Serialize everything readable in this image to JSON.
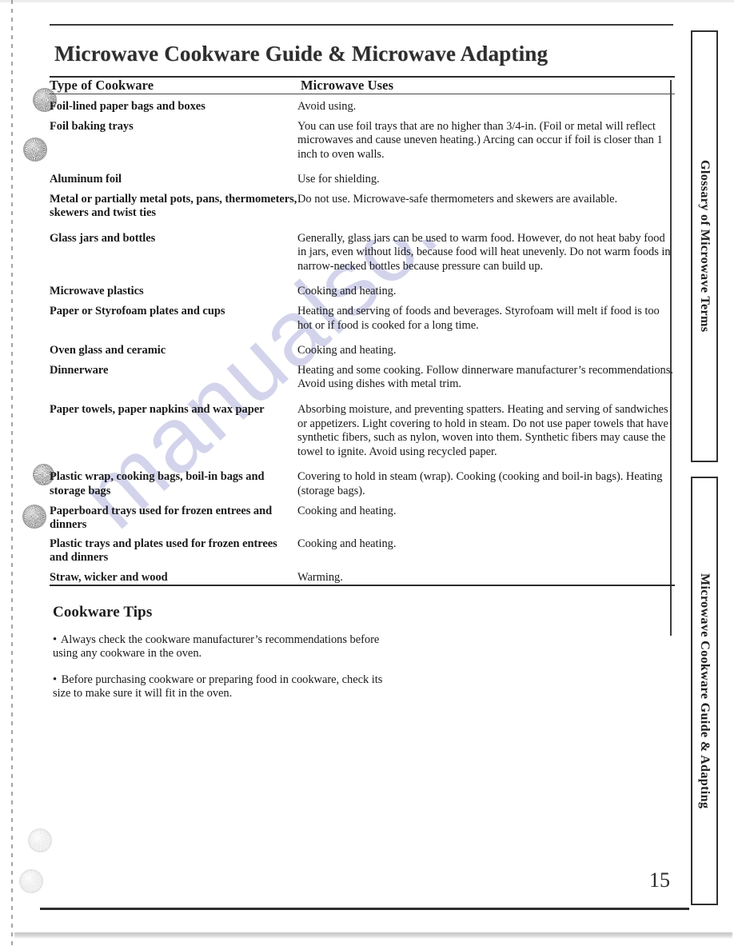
{
  "document": {
    "title": "Microwave Cookware Guide & Microwave Adapting",
    "page_number": "15",
    "watermark": "manualsonline.com"
  },
  "table": {
    "headers": {
      "type": "Type of Cookware",
      "uses": "Microwave Uses"
    },
    "rows": [
      {
        "type": "Foil-lined paper bags and boxes",
        "uses": "Avoid using."
      },
      {
        "type": "Foil baking trays",
        "uses": "You can use foil trays that are no higher than 3/4-in. (Foil or metal will reflect microwaves and cause uneven heating.) Arcing can occur if foil is closer than 1 inch to oven walls."
      },
      {
        "type": "Aluminum foil",
        "uses": "Use for shielding."
      },
      {
        "type": "Metal or partially metal pots, pans, thermometers, skewers and twist ties",
        "uses": "Do not use. Microwave-safe thermometers and skewers are available."
      },
      {
        "type": "Glass jars and bottles",
        "uses": "Generally, glass jars can be used to warm food. However, do not heat baby food in jars, even without lids, because food will heat unevenly. Do not warm foods in narrow-necked bottles because pressure can build up."
      },
      {
        "type": "Microwave plastics",
        "uses": "Cooking and heating."
      },
      {
        "type": "Paper or Styrofoam plates and cups",
        "uses": "Heating and serving of foods and beverages. Styrofoam will melt if food is too hot or if food is cooked for a long time."
      },
      {
        "type": "Oven glass and ceramic",
        "uses": "Cooking and heating."
      },
      {
        "type": "Dinnerware",
        "uses": "Heating and some cooking. Follow dinnerware manufacturer’s recommendations. Avoid using dishes with metal trim."
      },
      {
        "type": "Paper towels, paper napkins and wax paper",
        "uses": "Absorbing moisture, and preventing spatters. Heating and serving of sandwiches or appetizers. Light covering to hold in steam. Do not use paper towels that have synthetic fibers, such as nylon, woven into them. Synthetic fibers may cause the towel to ignite. Avoid using recycled paper."
      },
      {
        "type": "Plastic wrap, cooking bags, boil-in bags and storage bags",
        "uses": "Covering to hold in steam (wrap). Cooking (cooking and boil-in bags). Heating (storage bags)."
      },
      {
        "type": "Paperboard trays used for frozen entrees and dinners",
        "uses": "Cooking and heating."
      },
      {
        "type": "Plastic trays and plates used for frozen entrees and dinners",
        "uses": "Cooking and heating."
      },
      {
        "type": "Straw, wicker and wood",
        "uses": "Warming."
      }
    ]
  },
  "tips": {
    "title": "Cookware Tips",
    "items": [
      "Always check the cookware manufacturer’s recommendations before using any cookware in the oven.",
      "Before purchasing cookware or preparing food in cookware, check its size to make sure it will fit in the oven."
    ],
    "bullet": "•"
  },
  "side_tabs": [
    {
      "label": "Glossary of Microwave Terms"
    },
    {
      "label": "Microwave Cookware Guide & Adapting"
    }
  ]
}
